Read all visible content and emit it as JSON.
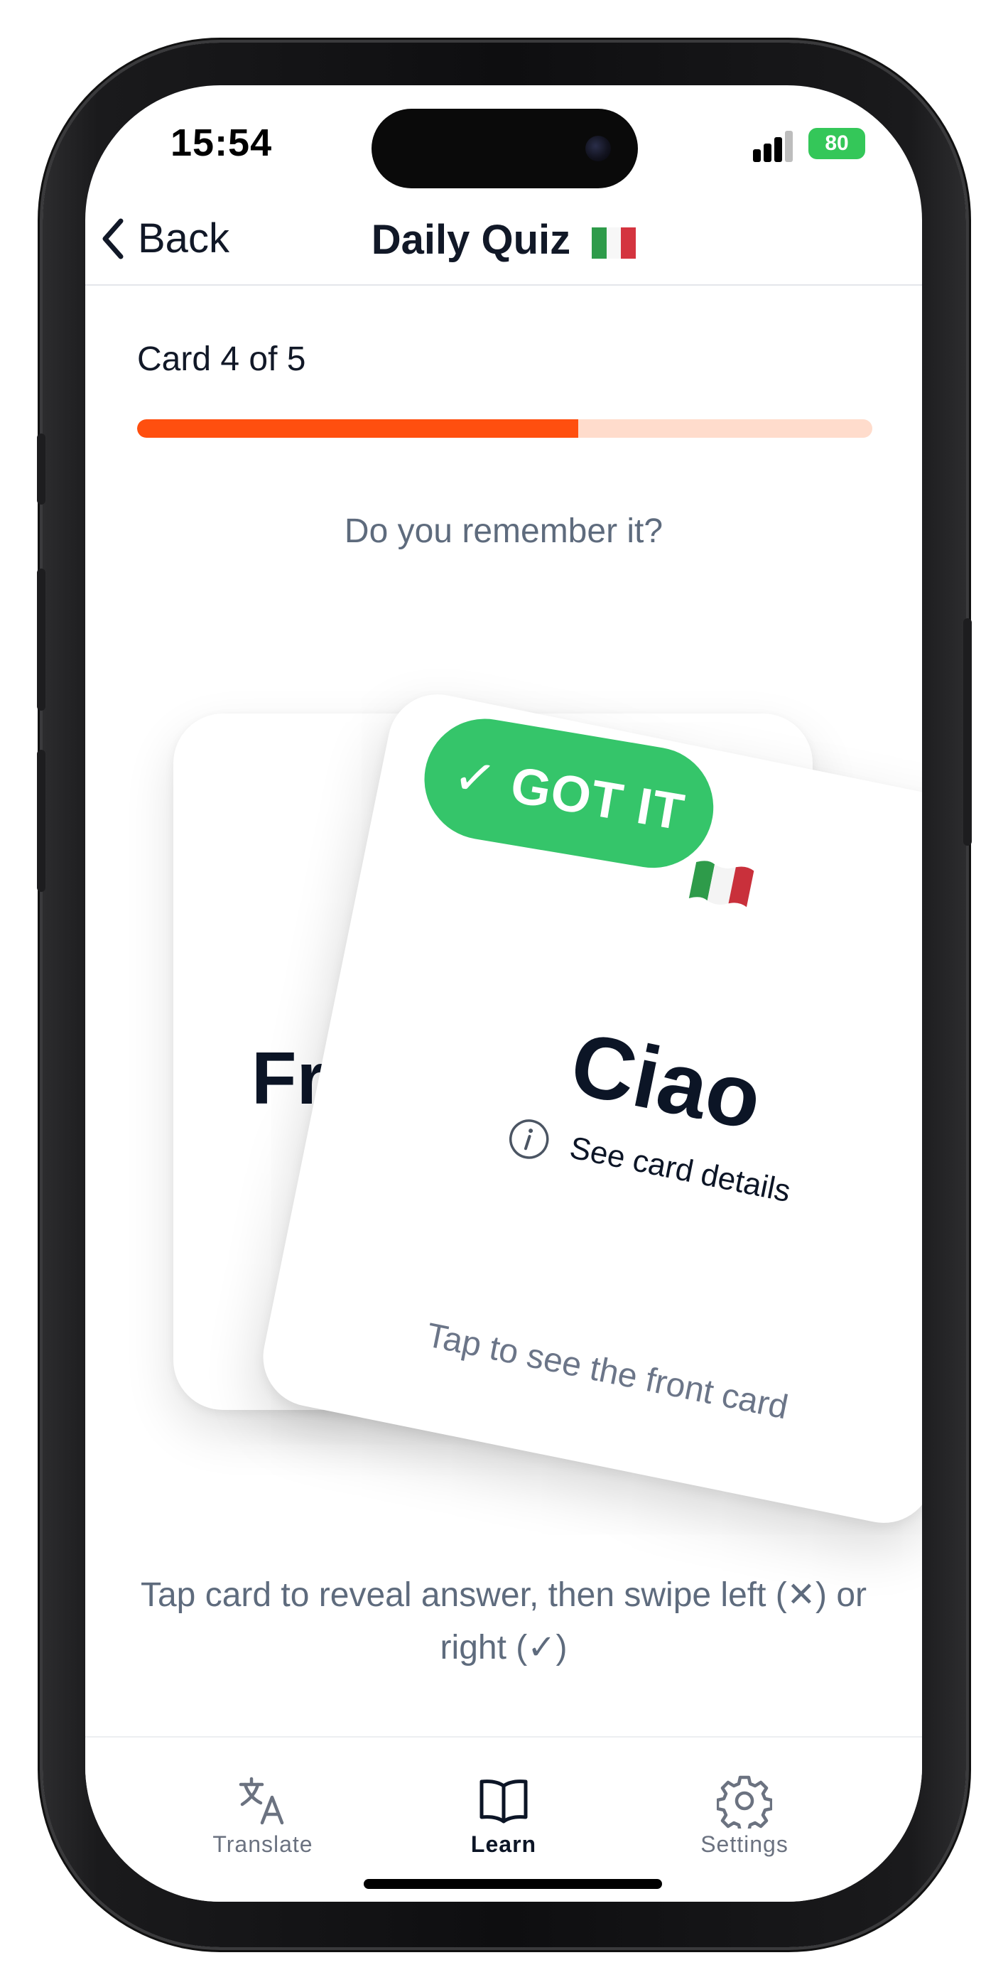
{
  "status_bar": {
    "time": "15:54",
    "battery": "80"
  },
  "nav": {
    "back_label": "Back",
    "title": "Daily Quiz"
  },
  "progress": {
    "label": "Card 4 of 5",
    "fraction": 0.6
  },
  "quiz": {
    "prompt": "Do you remember it?",
    "back_card_word": "Fri",
    "badge": "✓ GOT IT",
    "front_word": "Ciao",
    "details_link": "See card details",
    "tap_hint": "Tap to see the front card",
    "instructions": "Tap card to reveal answer, then swipe left (✕) or right (✓)"
  },
  "tabs": [
    {
      "label": "Translate",
      "icon": "translate-icon",
      "active": false
    },
    {
      "label": "Learn",
      "icon": "book-icon",
      "active": true
    },
    {
      "label": "Settings",
      "icon": "gear-icon",
      "active": false
    }
  ],
  "colors": {
    "accent": "#ff4f0f",
    "progress_track": "#ffdccc",
    "success": "#35c56a",
    "text_primary": "#0c1526",
    "text_muted": "#5e6b7d"
  }
}
